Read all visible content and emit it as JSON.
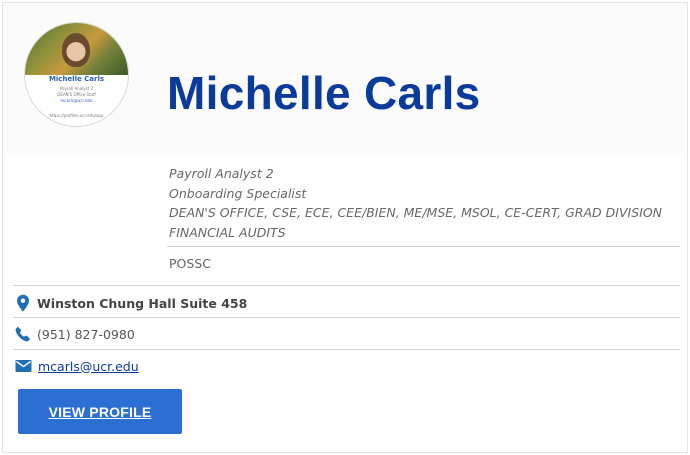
{
  "profile": {
    "name": "Michelle Carls",
    "avatar": {
      "name": "Michelle Carls",
      "line1": "Payroll Analyst 2",
      "line2": "DEAN'S Office Staff",
      "line3": "mcarls@ucr.edu",
      "line4": "https://profiles.ucr.edu/app"
    },
    "titles": [
      "Payroll Analyst 2",
      "Onboarding Specialist",
      "DEAN'S OFFICE, CSE, ECE, CEE/BIEN, ME/MSE, MSOL, CE-CERT, GRAD DIVISION",
      "FINANCIAL AUDITS"
    ],
    "department": "POSSC",
    "location": "Winston Chung Hall Suite 458",
    "phone": "(951) 827-0980",
    "email": "mcarls@ucr.edu",
    "view_profile_label": "VIEW PROFILE"
  },
  "colors": {
    "name_blue": "#0a3b9b",
    "button_blue": "#2a6fd1",
    "icon_blue": "#1f6fb5"
  },
  "icons": {
    "location": "map-pin-icon",
    "phone": "phone-icon",
    "email": "mail-icon"
  }
}
